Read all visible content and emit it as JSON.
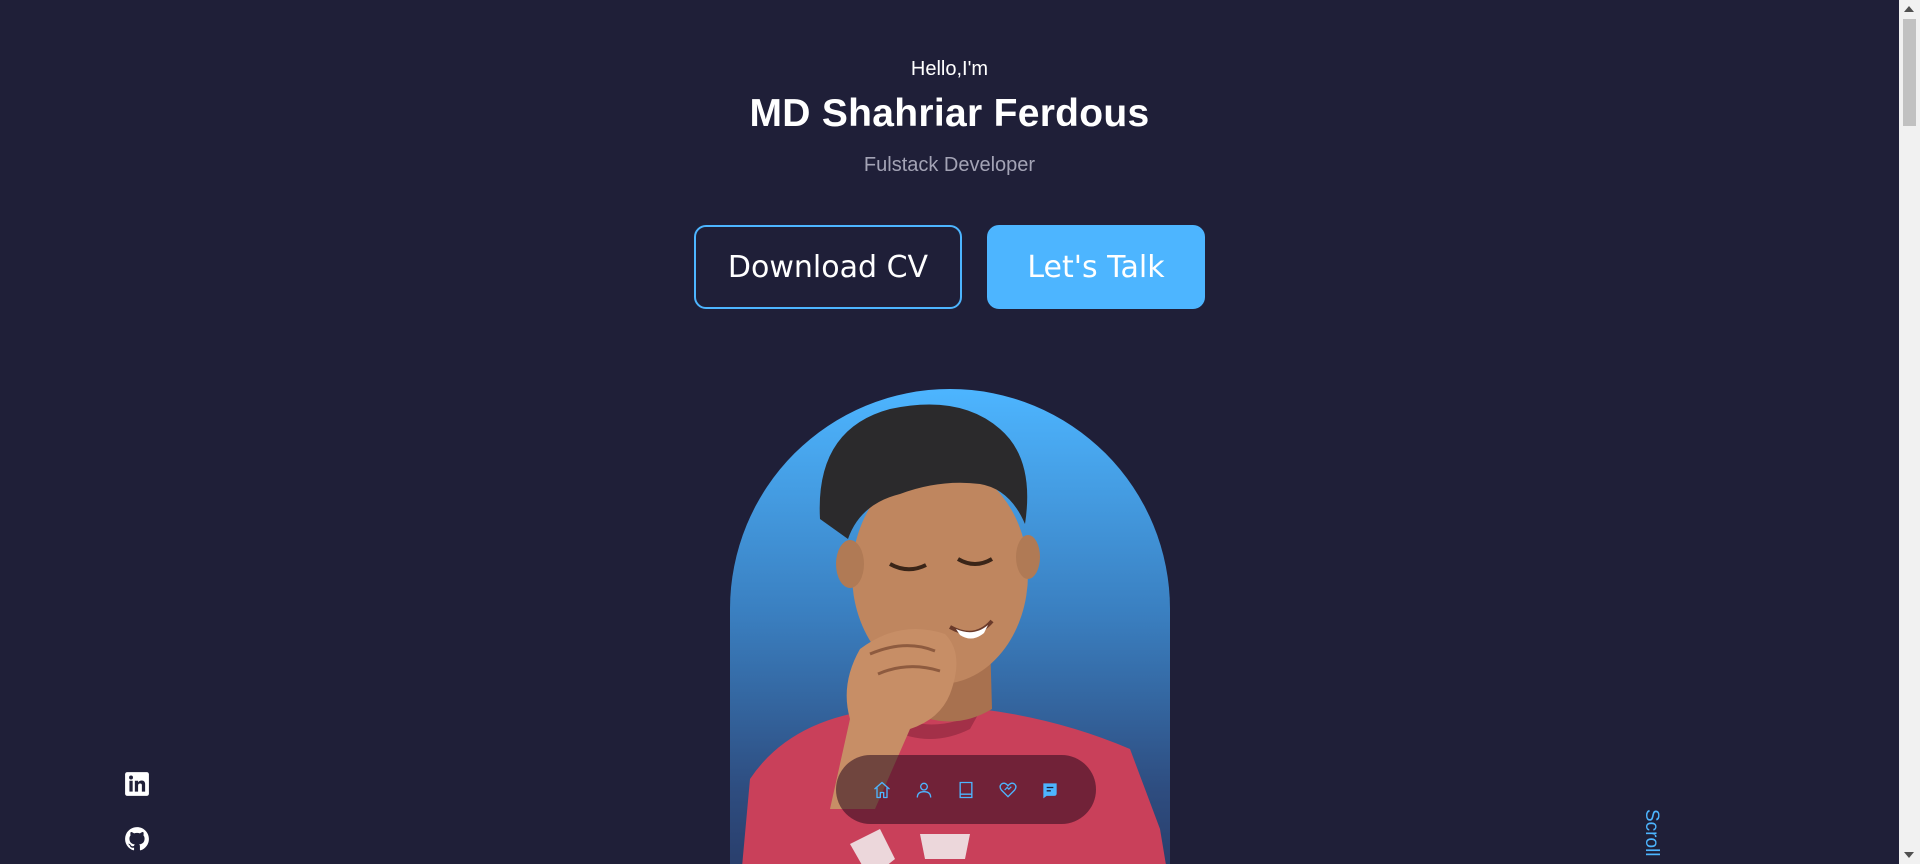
{
  "header": {
    "greeting": "Hello,I'm",
    "name": "MD Shahriar Ferdous",
    "role": "Fulstack Developer"
  },
  "cta": {
    "download_cv": "Download CV",
    "lets_talk": "Let's Talk"
  },
  "scroll_link": "Scroll",
  "nav": {
    "items": [
      "home-icon",
      "user-icon",
      "book-icon",
      "services-icon",
      "message-icon"
    ]
  },
  "social": [
    "linkedin-icon",
    "github-icon"
  ],
  "colors": {
    "background": "#1f1f38",
    "accent": "#4db5ff",
    "muted_text": "#a3a3b5"
  }
}
